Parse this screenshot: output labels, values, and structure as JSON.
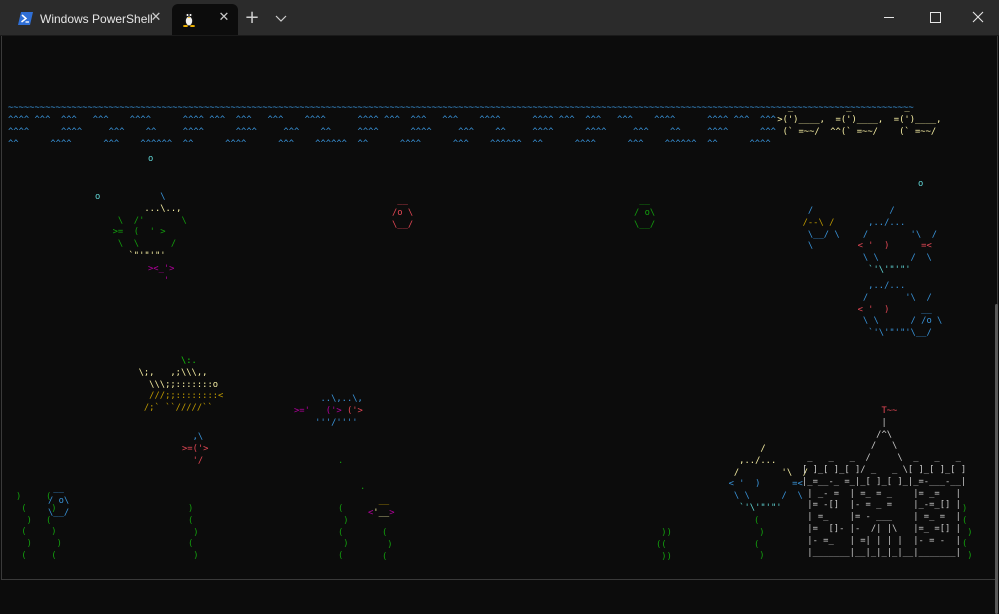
{
  "window": {
    "tabs": [
      {
        "title": "Windows PowerShell",
        "icon": "powershell-icon"
      },
      {
        "title": "",
        "icon": "linux-penguin-icon"
      }
    ],
    "new_tab_glyph": "+",
    "dropdown_glyph": "⌵",
    "close_glyph": "✕"
  },
  "terminal": {
    "program_output": "asciiquarium",
    "water": {
      "surface": "~~~~~~~~~~~~~~~~~~~~~~~~~~~~~~~~~~~~~~~~~~~~~~~~~~~~~~~~~~~~~~~~~~~~~~~~~~~~~~~~~~~~~~~~~~~~~~~~~~~~~~~~~~~~~~~~~~~~~~~~~~~~~~~~~~~~~~~~~~~~~~~~~~~~~~~~~~~~~~~~~~~~~~~~~~~",
      "line2": "^^^^ ^^^  ^^^   ^^^    ^^^^      ^^^^ ^^^  ^^^   ^^^    ^^^^      ^^^^ ^^^  ^^^   ^^^    ^^^^      ^^^^ ^^^  ^^^   ^^^    ^^^^      ^^^^ ^^^  ^^^",
      "line3": "^^^^      ^^^^     ^^^    ^^     ^^^^      ^^^^     ^^^    ^^     ^^^^      ^^^^     ^^^    ^^     ^^^^      ^^^^     ^^^    ^^     ^^^^      ^^^",
      "line4": "^^      ^^^^      ^^^    ^^^^^^  ^^      ^^^^      ^^^    ^^^^^^  ^^      ^^^^      ^^^    ^^^^^^  ^^      ^^^^      ^^^    ^^^^^^  ^^      ^^^^"
    }
  }
}
